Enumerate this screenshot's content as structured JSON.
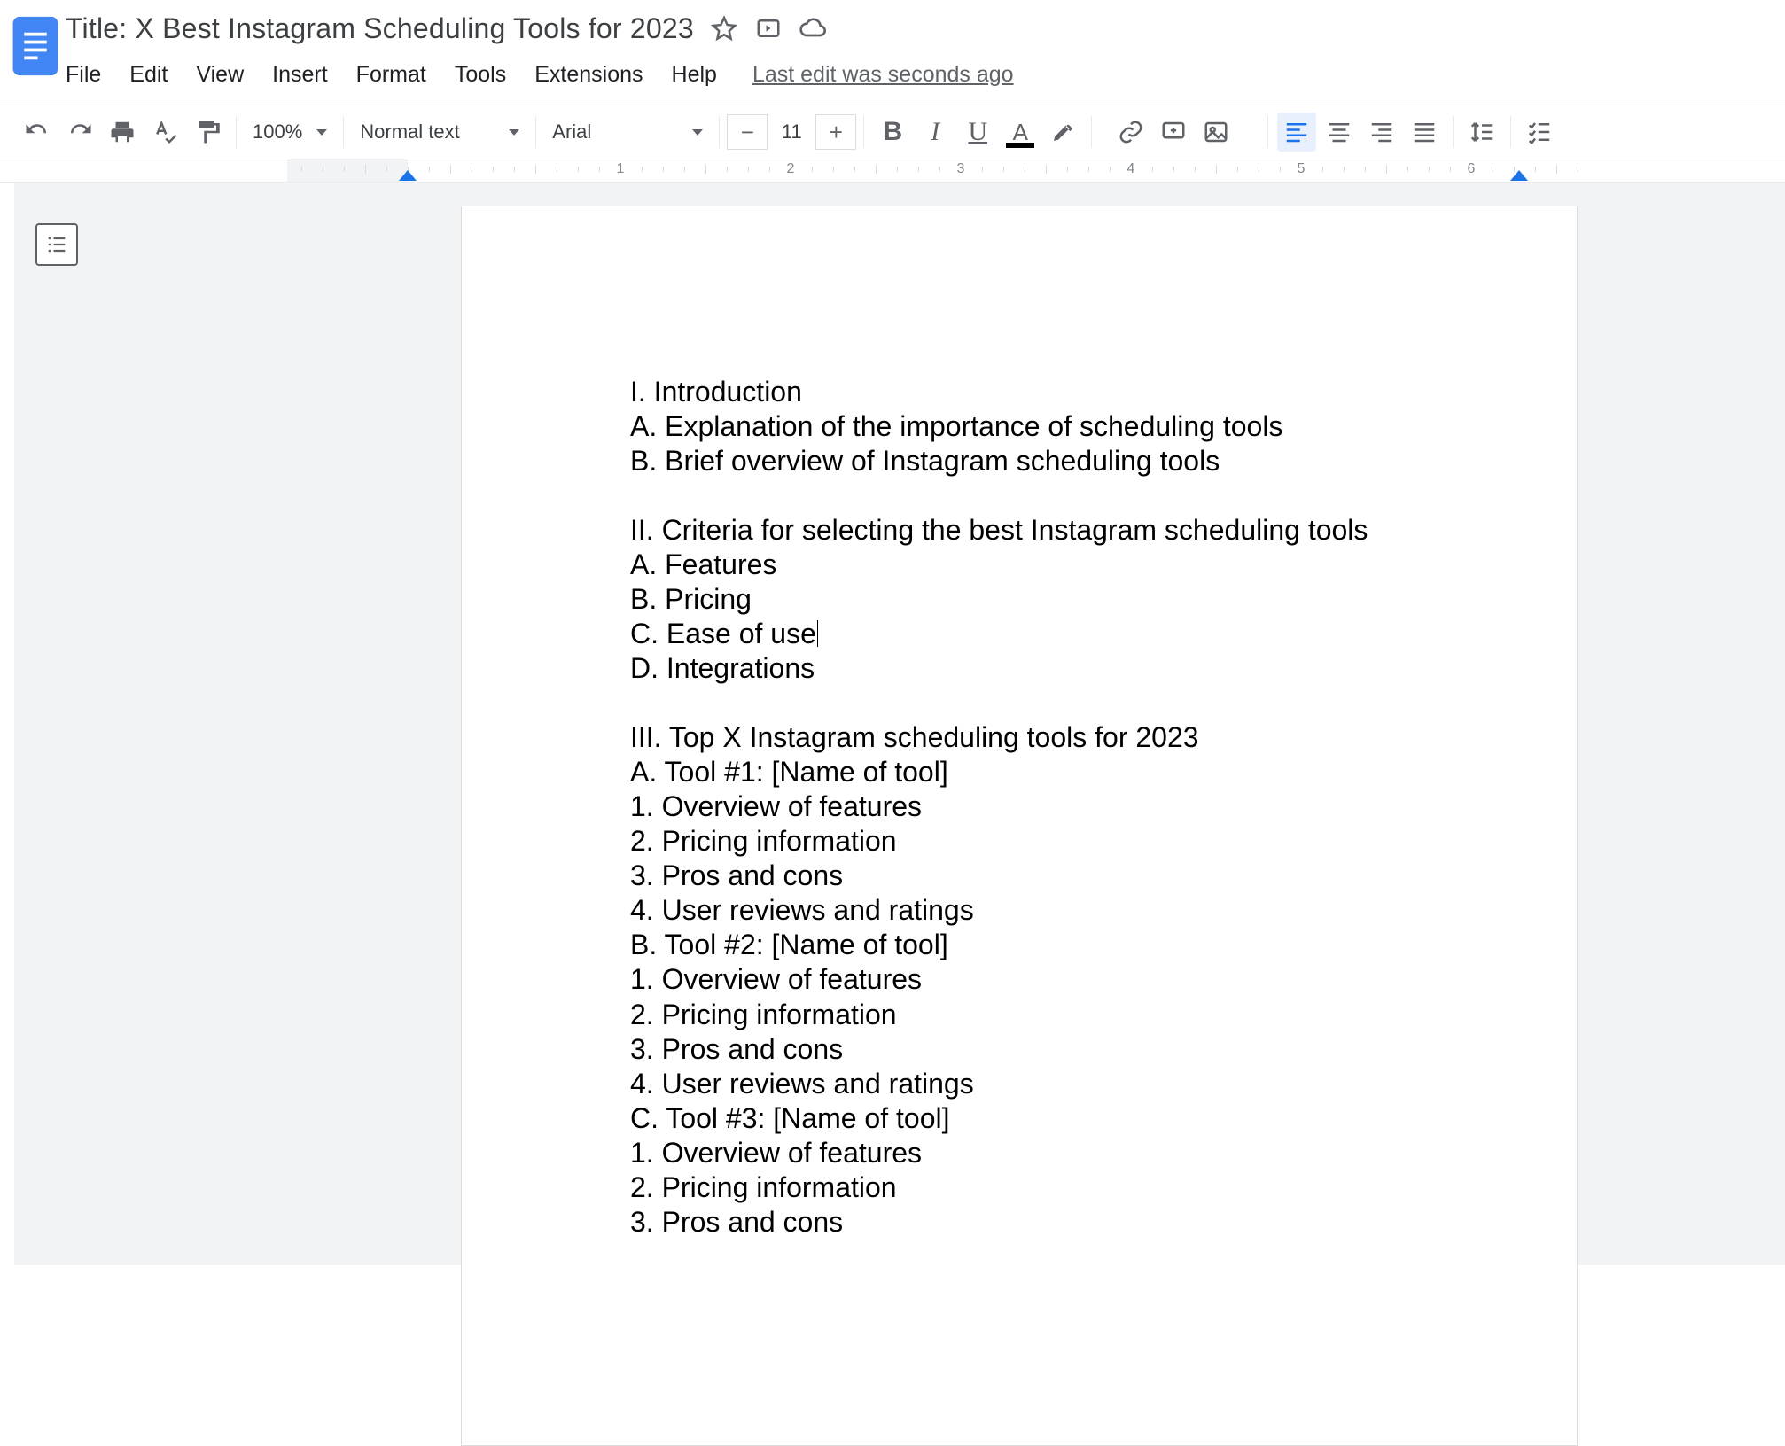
{
  "doc_title": "Title: X Best Instagram Scheduling Tools for 2023",
  "menu": {
    "items": [
      "File",
      "Edit",
      "View",
      "Insert",
      "Format",
      "Tools",
      "Extensions",
      "Help"
    ],
    "last_edit": "Last edit was seconds ago"
  },
  "toolbar": {
    "zoom": "100%",
    "style": "Normal text",
    "font": "Arial",
    "font_size": "11"
  },
  "ruler": {
    "labels": [
      "1",
      "2",
      "3",
      "4",
      "5",
      "6"
    ]
  },
  "document": {
    "cursor_line_index": 7,
    "lines": [
      "I. Introduction",
      "A. Explanation of the importance of scheduling tools",
      "B. Brief overview of Instagram scheduling tools",
      "",
      "II. Criteria for selecting the best Instagram scheduling tools",
      "A. Features",
      "B. Pricing",
      "C. Ease of use",
      "D. Integrations",
      "",
      "III. Top X Instagram scheduling tools for 2023",
      "A. Tool #1: [Name of tool]",
      "1. Overview of features",
      "2. Pricing information",
      "3. Pros and cons",
      "4. User reviews and ratings",
      "B. Tool #2: [Name of tool]",
      "1. Overview of features",
      "2. Pricing information",
      "3. Pros and cons",
      "4. User reviews and ratings",
      "C. Tool #3: [Name of tool]",
      "1. Overview of features",
      "2. Pricing information",
      "3. Pros and cons"
    ]
  }
}
